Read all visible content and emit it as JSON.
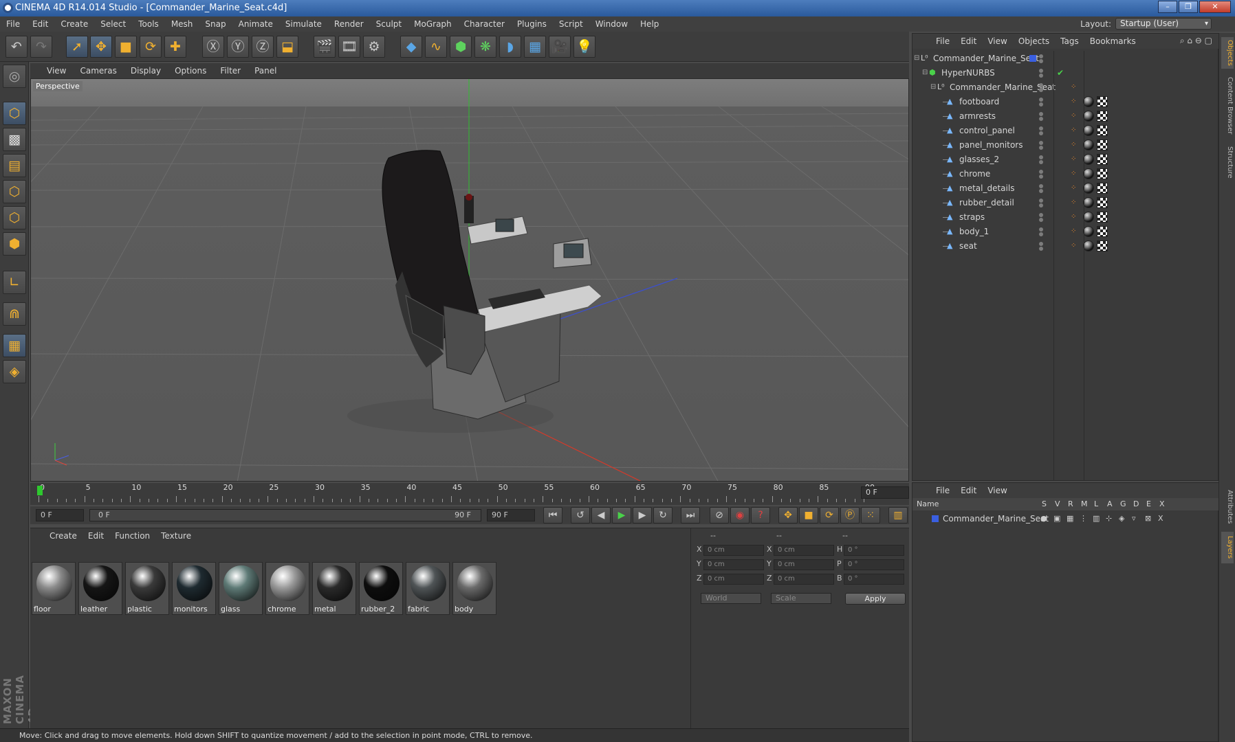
{
  "window": {
    "title": "CINEMA 4D R14.014 Studio - [Commander_Marine_Seat.c4d]",
    "buttons": [
      "–",
      "❐",
      "✕"
    ]
  },
  "menubar": [
    "File",
    "Edit",
    "Create",
    "Select",
    "Tools",
    "Mesh",
    "Snap",
    "Animate",
    "Simulate",
    "Render",
    "Sculpt",
    "MoGraph",
    "Character",
    "Plugins",
    "Script",
    "Window",
    "Help"
  ],
  "layout": {
    "label": "Layout:",
    "value": "Startup (User)"
  },
  "viewport": {
    "menu": [
      "View",
      "Cameras",
      "Display",
      "Options",
      "Filter",
      "Panel"
    ],
    "camera_label": "Perspective"
  },
  "timeline": {
    "ticks": [
      "0",
      "5",
      "10",
      "15",
      "20",
      "25",
      "30",
      "35",
      "40",
      "45",
      "50",
      "55",
      "60",
      "65",
      "70",
      "75",
      "80",
      "85",
      "90"
    ],
    "current": "0 F"
  },
  "transport": {
    "start": "0 F",
    "range_start": "0 F",
    "range_end": "90 F",
    "end": "90 F"
  },
  "materials": {
    "menu": [
      "Create",
      "Edit",
      "Function",
      "Texture"
    ],
    "items": [
      {
        "name": "floor",
        "color": "#8a8a8a"
      },
      {
        "name": "leather",
        "color": "#151515"
      },
      {
        "name": "plastic",
        "color": "#3a3a3a"
      },
      {
        "name": "monitors",
        "color": "#1e2a30"
      },
      {
        "name": "glass",
        "color": "#5e7a76"
      },
      {
        "name": "chrome",
        "color": "#9a9a9a"
      },
      {
        "name": "metal",
        "color": "#2a2a2a"
      },
      {
        "name": "rubber_2",
        "color": "#0d0d0d"
      },
      {
        "name": "fabric",
        "color": "#4f5456"
      },
      {
        "name": "body",
        "color": "#6a6a6a"
      }
    ]
  },
  "coordinates": {
    "headers": [
      "--",
      "--",
      "--"
    ],
    "rows": [
      {
        "a": "X",
        "av": "0 cm",
        "b": "X",
        "bv": "0 cm",
        "c": "H",
        "cv": "0 °"
      },
      {
        "a": "Y",
        "av": "0 cm",
        "b": "Y",
        "bv": "0 cm",
        "c": "P",
        "cv": "0 °"
      },
      {
        "a": "Z",
        "av": "0 cm",
        "b": "Z",
        "bv": "0 cm",
        "c": "B",
        "cv": "0 °"
      }
    ],
    "mode": "World",
    "scale": "Scale",
    "apply": "Apply"
  },
  "status": "Move: Click and drag to move elements. Hold down SHIFT to quantize movement / add to the selection in point mode, CTRL to remove.",
  "objects": {
    "menu": [
      "File",
      "Edit",
      "View",
      "Objects",
      "Tags",
      "Bookmarks"
    ],
    "tree": [
      {
        "name": "Commander_Marine_Seat",
        "level": 0,
        "icon": "null-icon"
      },
      {
        "name": "HyperNURBS",
        "level": 1,
        "icon": "hypernurbs-icon"
      },
      {
        "name": "Commander_Marine_Seat",
        "level": 2,
        "icon": "null-icon"
      },
      {
        "name": "footboard",
        "level": 3,
        "icon": "polygon-icon"
      },
      {
        "name": "armrests",
        "level": 3,
        "icon": "polygon-icon"
      },
      {
        "name": "control_panel",
        "level": 3,
        "icon": "polygon-icon"
      },
      {
        "name": "panel_monitors",
        "level": 3,
        "icon": "polygon-icon"
      },
      {
        "name": "glasses_2",
        "level": 3,
        "icon": "polygon-icon"
      },
      {
        "name": "chrome",
        "level": 3,
        "icon": "polygon-icon"
      },
      {
        "name": "metal_details",
        "level": 3,
        "icon": "polygon-icon"
      },
      {
        "name": "rubber_detail",
        "level": 3,
        "icon": "polygon-icon"
      },
      {
        "name": "straps",
        "level": 3,
        "icon": "polygon-icon"
      },
      {
        "name": "body_1",
        "level": 3,
        "icon": "polygon-icon"
      },
      {
        "name": "seat",
        "level": 3,
        "icon": "polygon-icon"
      }
    ]
  },
  "layers": {
    "menu": [
      "File",
      "Edit",
      "View"
    ],
    "columns": [
      "Name",
      "S",
      "V",
      "R",
      "M",
      "L",
      "A",
      "G",
      "D",
      "E",
      "X"
    ],
    "rows": [
      {
        "name": "Commander_Marine_Seat",
        "color": "#3a5fe0"
      }
    ]
  },
  "side_tabs": [
    "Objects",
    "Content Browser",
    "Structure",
    "Attributes",
    "Layers"
  ],
  "maxon": "MAXON CINEMA 4D",
  "colors": {
    "accent": "#f0b030",
    "selection": "#3c4d63",
    "title": "#2a5a9c"
  }
}
